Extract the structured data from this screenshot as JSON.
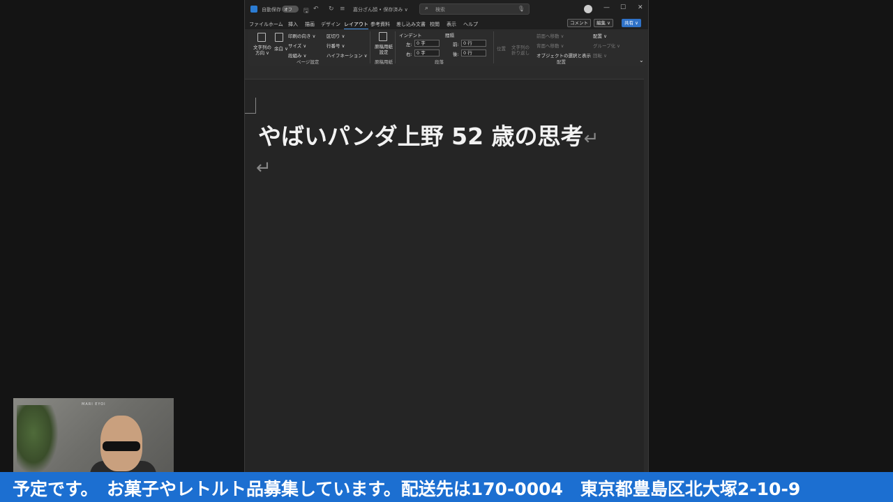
{
  "titlebar": {
    "autosave_label": "自動保存",
    "toggle_state": "オフ",
    "doc_name": "嘉分ざん顔",
    "save_state": "• 保存済み ∨",
    "search_placeholder": "検索"
  },
  "tabs": [
    "ファイル",
    "ホーム",
    "挿入",
    "描画",
    "デザイン",
    "レイアウト",
    "参考資料",
    "差し込み文書",
    "校閲",
    "表示",
    "ヘルプ"
  ],
  "active_tab": "レイアウト",
  "title_buttons": {
    "comment": "コメント",
    "edit": "編集 ∨",
    "share": "共有 ∨"
  },
  "ribbon": {
    "text_direction": "文字列の方向 ∨",
    "margins": "余白 ∨",
    "orientation": "印刷の向き ∨",
    "size": "サイズ ∨",
    "columns": "段組み ∨",
    "breaks": "区切り ∨",
    "line_numbers": "行番号 ∨",
    "hyphenation": "ハイフネーション ∨",
    "page_setup_group": "ページ設定",
    "manuscript": "原稿用紙設定",
    "manuscript_group": "原稿用紙",
    "indent_label": "インデント",
    "spacing_label": "間隔",
    "indent_left_label": "左:",
    "indent_left_value": "0 字",
    "indent_right_label": "右:",
    "indent_right_value": "0 字",
    "space_before_label": "前:",
    "space_before_value": "0 行",
    "space_after_label": "後:",
    "space_after_value": "0 行",
    "paragraph_group": "段落",
    "position": "位置",
    "wrap_text": "文字列の折り返し",
    "bring_forward": "前面へ移動 ∨",
    "send_backward": "背面へ移動 ∨",
    "selection_pane": "オブジェクトの選択と表示",
    "align": "配置 ∨",
    "group": "グループ化 ∨",
    "rotate": "回転 ∨",
    "arrange_group": "配置"
  },
  "document": {
    "heading": "やばいパンダ上野 52 歳の思考",
    "paragraph_mark": "↵"
  },
  "webcam": {
    "label": "MARI EYOI"
  },
  "ticker": {
    "text": "日　予定です。　お菓子やレトルト品募集しています。配送先は170-0004　東京都豊島区北大塚2-10-9"
  },
  "colors": {
    "accent": "#4a9cf0",
    "ticker_bg": "#1c6fd1",
    "share_bg": "#2f72c8"
  }
}
